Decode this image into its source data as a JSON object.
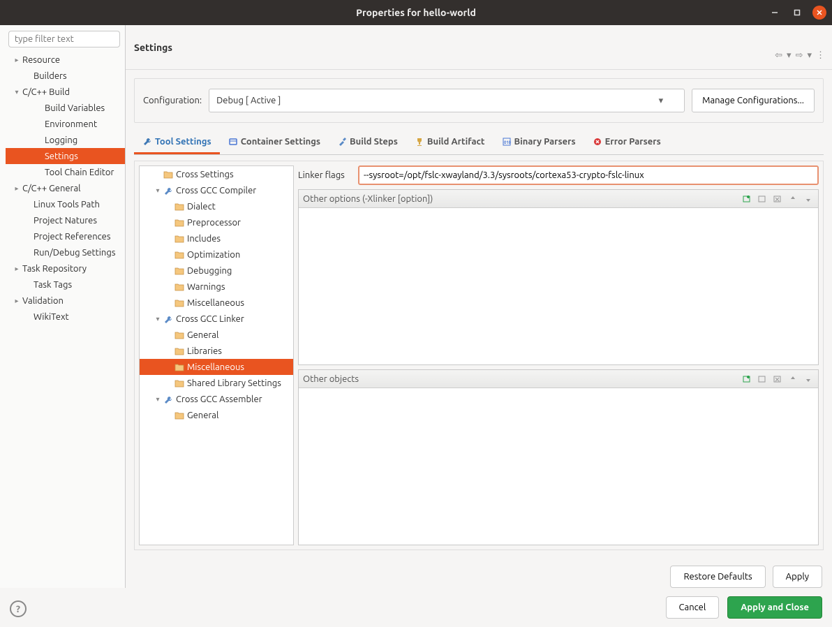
{
  "titlebar": {
    "title": "Properties for hello-world"
  },
  "sidebar": {
    "filter_placeholder": "type filter text",
    "items": [
      {
        "label": "Resource",
        "indent": 0,
        "arrow": "right"
      },
      {
        "label": "Builders",
        "indent": 1,
        "arrow": ""
      },
      {
        "label": "C/C++ Build",
        "indent": 0,
        "arrow": "down"
      },
      {
        "label": "Build Variables",
        "indent": 2,
        "arrow": ""
      },
      {
        "label": "Environment",
        "indent": 2,
        "arrow": ""
      },
      {
        "label": "Logging",
        "indent": 2,
        "arrow": ""
      },
      {
        "label": "Settings",
        "indent": 2,
        "arrow": "",
        "selected": true
      },
      {
        "label": "Tool Chain Editor",
        "indent": 2,
        "arrow": ""
      },
      {
        "label": "C/C++ General",
        "indent": 0,
        "arrow": "right"
      },
      {
        "label": "Linux Tools Path",
        "indent": 1,
        "arrow": ""
      },
      {
        "label": "Project Natures",
        "indent": 1,
        "arrow": ""
      },
      {
        "label": "Project References",
        "indent": 1,
        "arrow": ""
      },
      {
        "label": "Run/Debug Settings",
        "indent": 1,
        "arrow": ""
      },
      {
        "label": "Task Repository",
        "indent": 0,
        "arrow": "right"
      },
      {
        "label": "Task Tags",
        "indent": 1,
        "arrow": ""
      },
      {
        "label": "Validation",
        "indent": 0,
        "arrow": "right"
      },
      {
        "label": "WikiText",
        "indent": 1,
        "arrow": ""
      }
    ]
  },
  "header": {
    "title": "Settings"
  },
  "config": {
    "label": "Configuration:",
    "value": "Debug  [ Active ]",
    "manage": "Manage Configurations..."
  },
  "tabs": [
    {
      "label": "Tool Settings",
      "icon": "wrench",
      "active": true
    },
    {
      "label": "Container Settings",
      "icon": "container"
    },
    {
      "label": "Build Steps",
      "icon": "hammer"
    },
    {
      "label": "Build Artifact",
      "icon": "trophy"
    },
    {
      "label": "Binary Parsers",
      "icon": "binary"
    },
    {
      "label": "Error Parsers",
      "icon": "error"
    }
  ],
  "tooltree": [
    {
      "label": "Cross Settings",
      "indent": 1,
      "arrow": "",
      "icon": "folder"
    },
    {
      "label": "Cross GCC Compiler",
      "indent": 1,
      "arrow": "down",
      "icon": "wrench"
    },
    {
      "label": "Dialect",
      "indent": 2,
      "arrow": "",
      "icon": "folder"
    },
    {
      "label": "Preprocessor",
      "indent": 2,
      "arrow": "",
      "icon": "folder"
    },
    {
      "label": "Includes",
      "indent": 2,
      "arrow": "",
      "icon": "folder"
    },
    {
      "label": "Optimization",
      "indent": 2,
      "arrow": "",
      "icon": "folder"
    },
    {
      "label": "Debugging",
      "indent": 2,
      "arrow": "",
      "icon": "folder"
    },
    {
      "label": "Warnings",
      "indent": 2,
      "arrow": "",
      "icon": "folder"
    },
    {
      "label": "Miscellaneous",
      "indent": 2,
      "arrow": "",
      "icon": "folder"
    },
    {
      "label": "Cross GCC Linker",
      "indent": 1,
      "arrow": "down",
      "icon": "wrench"
    },
    {
      "label": "General",
      "indent": 2,
      "arrow": "",
      "icon": "folder"
    },
    {
      "label": "Libraries",
      "indent": 2,
      "arrow": "",
      "icon": "folder"
    },
    {
      "label": "Miscellaneous",
      "indent": 2,
      "arrow": "",
      "icon": "folder",
      "selected": true
    },
    {
      "label": "Shared Library Settings",
      "indent": 2,
      "arrow": "",
      "icon": "folder"
    },
    {
      "label": "Cross GCC Assembler",
      "indent": 1,
      "arrow": "down",
      "icon": "wrench"
    },
    {
      "label": "General",
      "indent": 2,
      "arrow": "",
      "icon": "folder"
    }
  ],
  "form": {
    "linker_flags_label": "Linker flags",
    "linker_flags_value": "--sysroot=/opt/fslc-xwayland/3.3/sysroots/cortexa53-crypto-fslc-linux",
    "other_options_label": "Other options (-Xlinker [option])",
    "other_objects_label": "Other objects"
  },
  "buttons": {
    "restore_defaults": "Restore Defaults",
    "apply": "Apply",
    "cancel": "Cancel",
    "apply_close": "Apply and Close"
  }
}
